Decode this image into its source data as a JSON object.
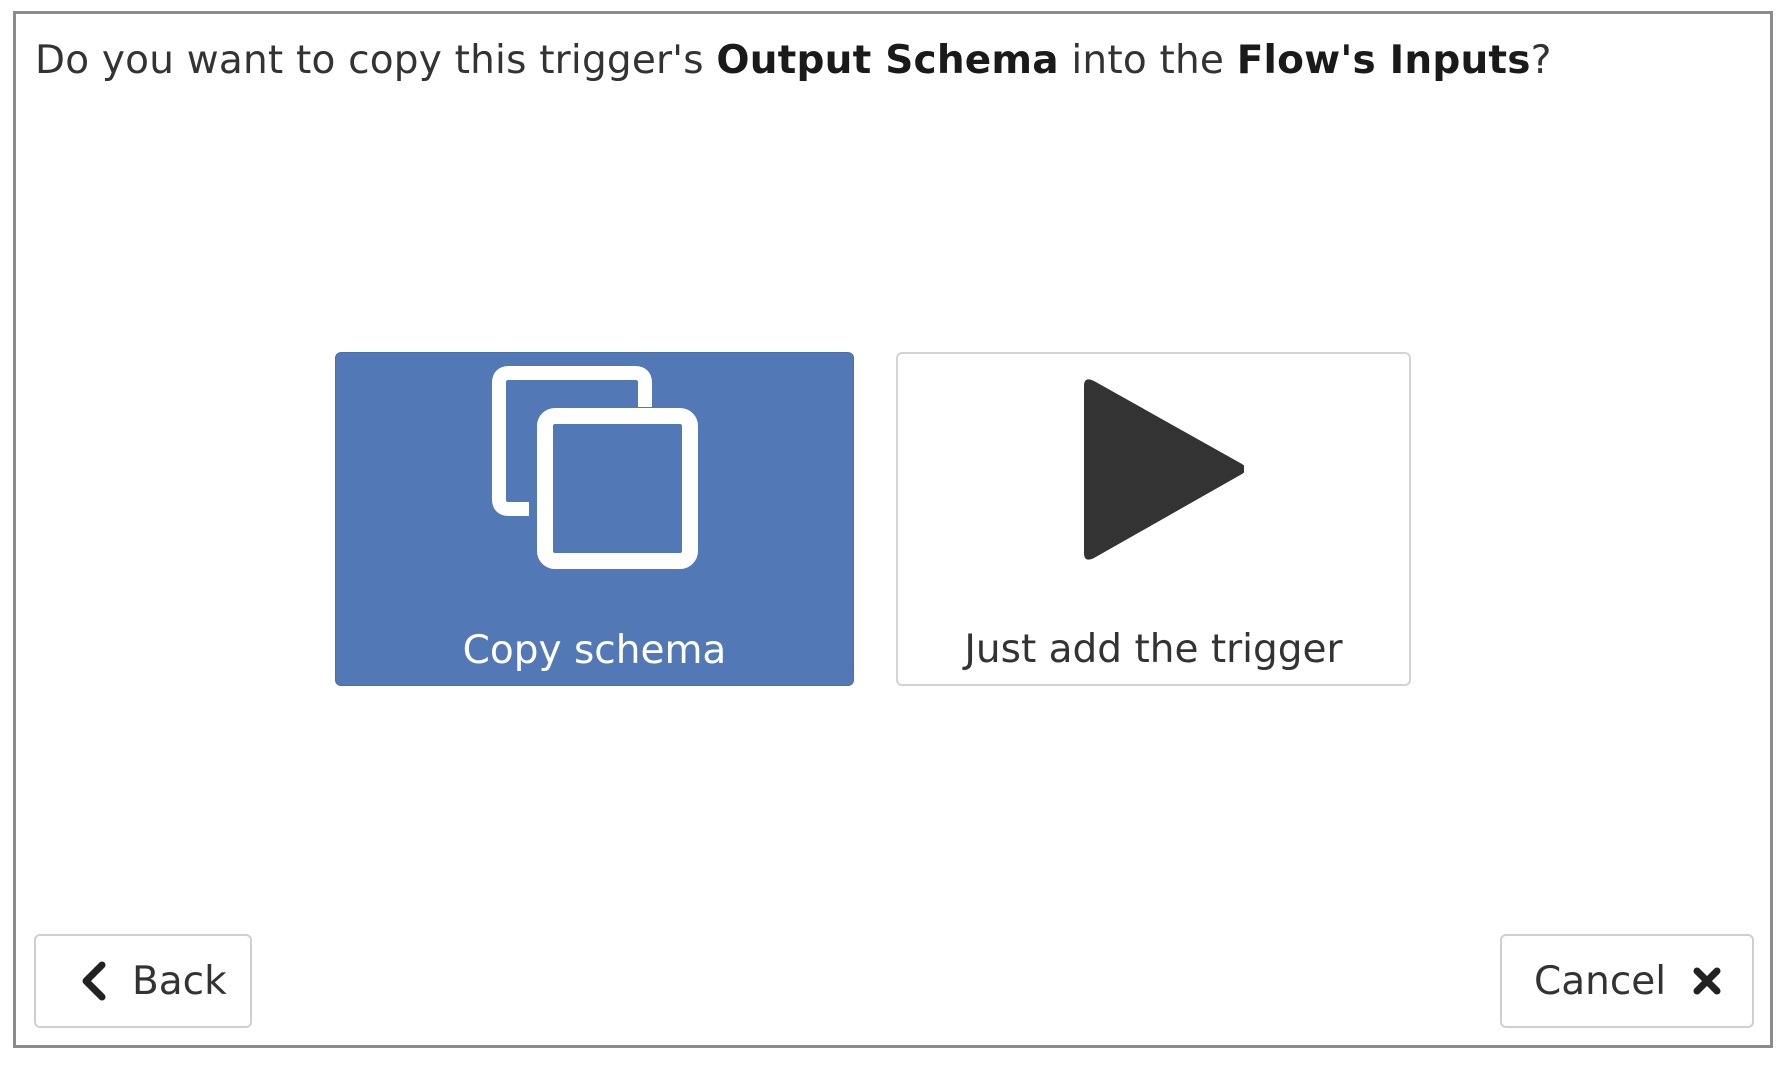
{
  "dialog": {
    "question": {
      "prefix": "Do you want to copy this trigger's ",
      "bold1": "Output Schema",
      "middle": " into the ",
      "bold2": "Flow's Inputs",
      "suffix": "?"
    },
    "choices": [
      {
        "label": "Copy schema",
        "icon": "copy-icon",
        "selected": true
      },
      {
        "label": "Just add the trigger",
        "icon": "play-icon",
        "selected": false
      }
    ],
    "buttons": {
      "back_label": "Back",
      "back_icon": "chevron-left-icon",
      "cancel_label": "Cancel",
      "cancel_icon": "close-icon"
    }
  },
  "colors": {
    "accent": "#5279b6",
    "text": "#333333",
    "border": "#8c8c8c"
  }
}
